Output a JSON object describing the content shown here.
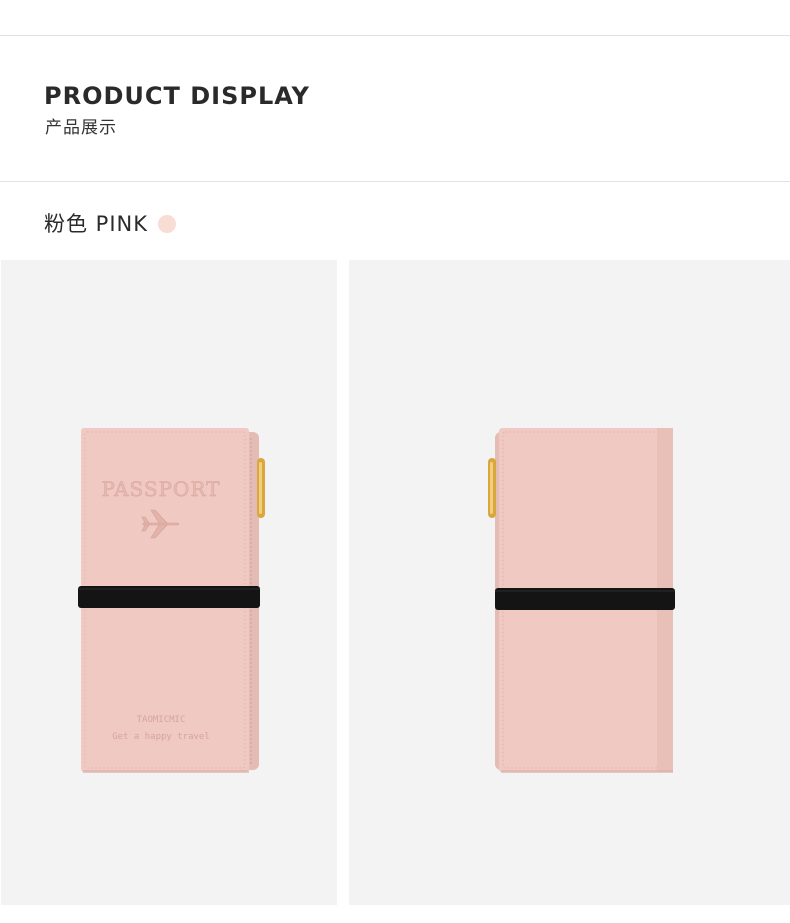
{
  "section": {
    "title": "PRODUCT DISPLAY",
    "subtitle": "产品展示"
  },
  "color_option": {
    "label": "粉色 PINK",
    "swatch_color": "#f7ddd4"
  },
  "products": [
    {
      "view": "front",
      "emboss_title": "PASSPORT",
      "brand": "TAOMICMIC",
      "tagline": "Get a happy travel",
      "icon": "airplane-icon"
    },
    {
      "view": "back"
    }
  ],
  "colors": {
    "leather": "#efc9c2",
    "leather_shadow": "#ddb2aa",
    "strap": "#141414",
    "zipper": "#d9a73d",
    "panel_bg": "#f3f3f3"
  }
}
